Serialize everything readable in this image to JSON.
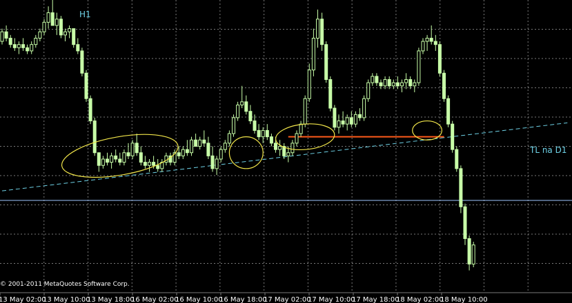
{
  "chart_data": {
    "type": "candlestick",
    "timeframe_label": "H1",
    "copyright": "© 2001-2011 MetaQuotes Software Corp.",
    "trendline_label": "TL na D1",
    "grid": true,
    "x_tick_labels": [
      "13 May 02:00",
      "13 May 10:00",
      "13 May 18:00",
      "16 May 02:00",
      "16 May 10:00",
      "16 May 18:00",
      "17 May 02:00",
      "17 May 10:00",
      "17 May 18:00",
      "18 May 02:00",
      "18 May 10:00"
    ],
    "candles": [
      [
        99,
        103,
        98,
        102
      ],
      [
        102,
        104,
        99,
        100
      ],
      [
        100,
        101,
        97,
        98
      ],
      [
        98,
        100,
        96,
        97
      ],
      [
        97,
        99,
        95,
        98
      ],
      [
        98,
        100,
        96,
        97
      ],
      [
        97,
        98,
        95,
        96
      ],
      [
        96,
        99,
        95,
        98
      ],
      [
        98,
        101,
        97,
        100
      ],
      [
        100,
        103,
        99,
        102
      ],
      [
        102,
        106,
        101,
        105
      ],
      [
        105,
        110,
        103,
        108
      ],
      [
        108,
        112,
        104,
        104
      ],
      [
        104,
        108,
        101,
        106
      ],
      [
        106,
        107,
        100,
        101
      ],
      [
        101,
        103,
        99,
        102
      ],
      [
        102,
        104,
        100,
        103
      ],
      [
        103,
        103,
        97,
        98
      ],
      [
        98,
        100,
        95,
        96
      ],
      [
        96,
        97,
        88,
        89
      ],
      [
        89,
        90,
        80,
        81
      ],
      [
        81,
        82,
        73,
        74
      ],
      [
        74,
        75,
        63,
        64
      ],
      [
        64,
        64,
        58,
        60
      ],
      [
        60,
        63,
        59,
        62
      ],
      [
        62,
        64,
        60,
        61
      ],
      [
        61,
        64,
        59,
        63
      ],
      [
        63,
        65,
        61,
        62
      ],
      [
        62,
        64,
        60,
        61
      ],
      [
        61,
        65,
        60,
        64
      ],
      [
        64,
        67,
        62,
        63
      ],
      [
        63,
        68,
        62,
        67
      ],
      [
        67,
        70,
        63,
        64
      ],
      [
        64,
        66,
        60,
        61
      ],
      [
        61,
        63,
        59,
        60
      ],
      [
        60,
        62,
        58,
        61
      ],
      [
        61,
        63,
        59,
        60
      ],
      [
        60,
        62,
        58,
        59
      ],
      [
        59,
        62,
        58,
        61
      ],
      [
        61,
        64,
        60,
        63
      ],
      [
        63,
        64,
        60,
        61
      ],
      [
        61,
        65,
        60,
        64
      ],
      [
        64,
        66,
        62,
        63
      ],
      [
        63,
        66,
        62,
        65
      ],
      [
        65,
        68,
        63,
        64
      ],
      [
        64,
        69,
        63,
        68
      ],
      [
        68,
        70,
        66,
        66
      ],
      [
        66,
        69,
        65,
        68
      ],
      [
        68,
        71,
        66,
        67
      ],
      [
        67,
        69,
        62,
        63
      ],
      [
        63,
        66,
        58,
        59
      ],
      [
        59,
        63,
        57,
        62
      ],
      [
        62,
        66,
        61,
        65
      ],
      [
        65,
        68,
        64,
        67
      ],
      [
        67,
        71,
        66,
        70
      ],
      [
        70,
        76,
        69,
        75
      ],
      [
        75,
        80,
        74,
        79
      ],
      [
        79,
        85,
        78,
        80
      ],
      [
        80,
        82,
        76,
        77
      ],
      [
        77,
        79,
        73,
        74
      ],
      [
        74,
        76,
        70,
        71
      ],
      [
        71,
        73,
        68,
        69
      ],
      [
        69,
        72,
        67,
        71
      ],
      [
        71,
        73,
        68,
        69
      ],
      [
        69,
        70,
        66,
        67
      ],
      [
        67,
        69,
        64,
        65
      ],
      [
        65,
        68,
        63,
        66
      ],
      [
        66,
        67,
        62,
        63
      ],
      [
        63,
        66,
        61,
        64
      ],
      [
        64,
        68,
        63,
        67
      ],
      [
        67,
        71,
        66,
        70
      ],
      [
        70,
        74,
        69,
        73
      ],
      [
        73,
        82,
        72,
        81
      ],
      [
        81,
        92,
        80,
        90
      ],
      [
        90,
        103,
        88,
        100
      ],
      [
        100,
        109,
        97,
        106
      ],
      [
        106,
        108,
        96,
        98
      ],
      [
        98,
        99,
        86,
        87
      ],
      [
        87,
        88,
        77,
        78
      ],
      [
        78,
        79,
        71,
        72
      ],
      [
        72,
        76,
        70,
        74
      ],
      [
        74,
        77,
        72,
        73
      ],
      [
        73,
        76,
        71,
        75
      ],
      [
        75,
        77,
        72,
        73
      ],
      [
        73,
        77,
        72,
        76
      ],
      [
        76,
        78,
        74,
        75
      ],
      [
        75,
        82,
        74,
        81
      ],
      [
        81,
        87,
        80,
        86
      ],
      [
        86,
        89,
        85,
        88
      ],
      [
        88,
        89,
        85,
        86
      ],
      [
        86,
        87,
        84,
        85
      ],
      [
        85,
        88,
        84,
        87
      ],
      [
        87,
        88,
        84,
        85
      ],
      [
        85,
        87,
        84,
        86
      ],
      [
        86,
        88,
        84,
        85
      ],
      [
        85,
        87,
        83,
        86
      ],
      [
        86,
        89,
        84,
        87
      ],
      [
        87,
        88,
        84,
        85
      ],
      [
        85,
        87,
        83,
        86
      ],
      [
        86,
        97,
        85,
        96
      ],
      [
        96,
        100,
        95,
        99
      ],
      [
        99,
        101,
        96,
        100
      ],
      [
        100,
        104,
        98,
        99
      ],
      [
        99,
        101,
        96,
        98
      ],
      [
        98,
        99,
        88,
        89
      ],
      [
        89,
        90,
        80,
        81
      ],
      [
        81,
        82,
        72,
        73
      ],
      [
        73,
        74,
        64,
        65
      ],
      [
        65,
        66,
        58,
        59
      ],
      [
        59,
        60,
        45,
        47
      ],
      [
        47,
        48,
        35,
        37
      ],
      [
        37,
        38,
        27,
        29
      ],
      [
        29,
        36,
        28,
        35
      ]
    ],
    "ylim": [
      20,
      112
    ],
    "grid_rows": 10,
    "grid_cols": 13,
    "horizontal_line": {
      "y": 49,
      "color": "#9fc7ff"
    },
    "trendline": {
      "from": [
        0,
        52
      ],
      "to": [
        113,
        70
      ],
      "color": "#6fd3e8"
    },
    "resistance_line": {
      "from": [
        68,
        69
      ],
      "to": [
        105,
        69
      ],
      "color": "#ff5a1a"
    },
    "highlights": [
      {
        "cx": 28,
        "cy": 63,
        "rx": 14,
        "ry": 6,
        "rotate": -10
      },
      {
        "cx": 58,
        "cy": 64,
        "rx": 4,
        "ry": 5,
        "rotate": 0
      },
      {
        "cx": 72,
        "cy": 69,
        "rx": 7,
        "ry": 4,
        "rotate": -5
      },
      {
        "cx": 101,
        "cy": 71,
        "rx": 3.5,
        "ry": 3,
        "rotate": 0
      }
    ],
    "colors": {
      "background": "#000000",
      "grid": "#7a7a7a",
      "candle": "#c8ffa8",
      "axis_text": "#ffffff",
      "label": "#6fd3e8",
      "highlight": "#f2e64a"
    }
  }
}
